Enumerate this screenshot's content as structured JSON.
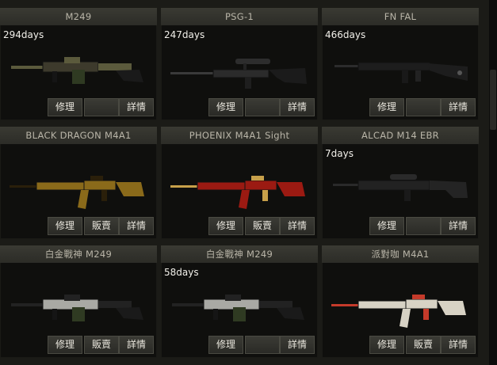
{
  "cards": [
    {
      "name": "M249",
      "days": "294days",
      "buttons": [
        "修理",
        "",
        "詳情"
      ],
      "gun": "machinegun",
      "colors": [
        "#3d3a2c",
        "#5b5a3c"
      ]
    },
    {
      "name": "PSG-1",
      "days": "247days",
      "buttons": [
        "修理",
        "",
        "詳情"
      ],
      "gun": "sniper",
      "colors": [
        "#2b2b2b",
        "#444"
      ]
    },
    {
      "name": "FN FAL",
      "days": "466days",
      "buttons": [
        "修理",
        "",
        "詳情"
      ],
      "gun": "rifle",
      "colors": [
        "#1d1d1d",
        "#3a3a3a"
      ]
    },
    {
      "name": "BLACK DRAGON M4A1",
      "days": "",
      "buttons": [
        "修理",
        "販賣",
        "詳情"
      ],
      "gun": "m4",
      "colors": [
        "#8a6a1a",
        "#2a1f0a"
      ]
    },
    {
      "name": "PHOENIX M4A1 Sight",
      "days": "",
      "buttons": [
        "修理",
        "販賣",
        "詳情"
      ],
      "gun": "m4",
      "colors": [
        "#9b1a12",
        "#c7a04a"
      ]
    },
    {
      "name": "ALCAD M14 EBR",
      "days": "7days",
      "buttons": [
        "修理",
        "",
        "詳情"
      ],
      "gun": "ebr",
      "colors": [
        "#222",
        "#3b3b3b"
      ]
    },
    {
      "name": "白金戰神 M249",
      "days": "",
      "buttons": [
        "修理",
        "販賣",
        "詳情"
      ],
      "gun": "machinegun",
      "colors": [
        "#a9a9a4",
        "#222"
      ]
    },
    {
      "name": "白金戰神 M249",
      "days": "58days",
      "buttons": [
        "修理",
        "",
        "詳情"
      ],
      "gun": "machinegun",
      "colors": [
        "#a9a9a4",
        "#222"
      ]
    },
    {
      "name": "派對咖 M4A1",
      "days": "",
      "buttons": [
        "修理",
        "販賣",
        "詳情"
      ],
      "gun": "m4",
      "colors": [
        "#d7d2c4",
        "#c43a2a"
      ]
    }
  ]
}
